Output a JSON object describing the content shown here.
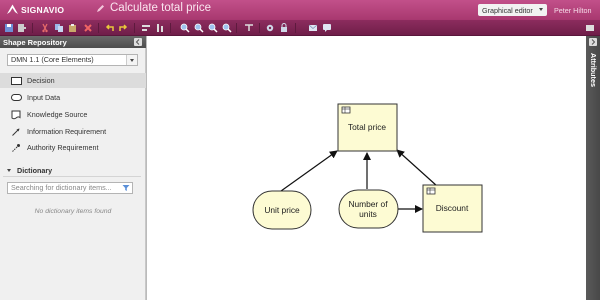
{
  "header": {
    "brand": "SIGNAVIO",
    "doc_title": "Calculate total price",
    "editor_mode": "Graphical editor",
    "user": "Peter Hilton"
  },
  "left_panel": {
    "title": "Shape Repository",
    "palette_select": "DMN 1.1 (Core Elements)",
    "shapes": [
      {
        "label": "Decision",
        "icon": "decision-icon",
        "selected": true
      },
      {
        "label": "Input Data",
        "icon": "input-data-icon"
      },
      {
        "label": "Knowledge Source",
        "icon": "knowledge-source-icon"
      },
      {
        "label": "Information Requirement",
        "icon": "information-requirement-icon"
      },
      {
        "label": "Authority Requirement",
        "icon": "authority-requirement-icon"
      }
    ],
    "dictionary": {
      "title": "Dictionary",
      "search_placeholder": "Searching for dictionary items...",
      "empty_message": "No dictionary items found"
    }
  },
  "diagram": {
    "decisions": {
      "total_price": "Total price",
      "discount": "Discount"
    },
    "inputs": {
      "unit_price": "Unit price",
      "number_line1": "Number of",
      "number_line2": "units"
    }
  },
  "right_panel": {
    "title": "Attributes"
  },
  "colors": {
    "accent": "#b3437a",
    "toolbar": "#7d2553",
    "node_fill": "#fdfbd3"
  }
}
